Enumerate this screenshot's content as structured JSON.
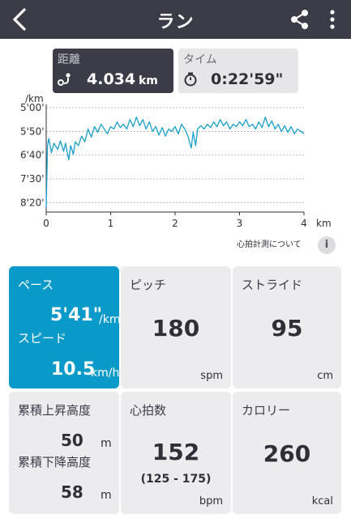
{
  "header": {
    "title": "ラン",
    "back_icon": "arrow-left-icon",
    "share_icon": "share-icon",
    "more_icon": "more-vertical-icon"
  },
  "tabs": [
    {
      "label": "距離",
      "value": "4.034",
      "unit": "km",
      "icon": "route-icon",
      "selected": true
    },
    {
      "label": "タイム",
      "value": "0:22'59\"",
      "icon": "stopwatch-icon",
      "selected": false
    }
  ],
  "chart_data": {
    "type": "line",
    "ylabel_unit": "/km",
    "xlabel": "km",
    "y_ticks": [
      "5'00'",
      "5'50'",
      "6'40'",
      "7'30'",
      "8'20'"
    ],
    "y_tick_seconds": [
      300,
      350,
      400,
      450,
      500
    ],
    "x_ticks": [
      "0",
      "1",
      "2",
      "3",
      "4"
    ],
    "xlim": [
      0,
      4
    ],
    "ylim_seconds_per_km": [
      300,
      520
    ],
    "y_inverted": true,
    "grid": true,
    "line_color": "#1a9fc9",
    "series": [
      {
        "x": [
          0,
          0.02,
          0.04,
          0.08,
          0.12,
          0.18,
          0.22,
          0.27,
          0.3,
          0.35,
          0.38,
          0.42,
          0.45,
          0.5,
          0.55,
          0.6,
          0.65,
          0.7,
          0.75,
          0.8,
          0.85,
          0.9,
          0.95,
          1.0,
          1.05,
          1.1,
          1.15,
          1.2,
          1.25,
          1.3,
          1.35,
          1.4,
          1.45,
          1.5,
          1.55,
          1.6,
          1.65,
          1.7,
          1.75,
          1.8,
          1.85,
          1.9,
          1.95,
          2.0,
          2.05,
          2.1,
          2.15,
          2.2,
          2.25,
          2.28,
          2.32,
          2.35,
          2.4,
          2.45,
          2.5,
          2.55,
          2.6,
          2.65,
          2.7,
          2.75,
          2.8,
          2.85,
          2.9,
          2.95,
          3.0,
          3.05,
          3.1,
          3.15,
          3.2,
          3.25,
          3.3,
          3.35,
          3.4,
          3.45,
          3.5,
          3.55,
          3.6,
          3.65,
          3.7,
          3.75,
          3.8,
          3.85,
          3.9,
          3.95,
          4.0
        ],
        "y": [
          510,
          380,
          365,
          395,
          375,
          388,
          370,
          392,
          375,
          410,
          380,
          398,
          372,
          380,
          360,
          372,
          345,
          362,
          340,
          352,
          335,
          345,
          355,
          340,
          345,
          330,
          342,
          335,
          345,
          325,
          340,
          320,
          338,
          325,
          345,
          330,
          350,
          340,
          358,
          342,
          360,
          345,
          350,
          340,
          355,
          335,
          345,
          360,
          385,
          352,
          380,
          345,
          338,
          345,
          335,
          342,
          330,
          340,
          325,
          338,
          330,
          345,
          335,
          340,
          330,
          338,
          325,
          340,
          335,
          345,
          330,
          342,
          320,
          340,
          328,
          345,
          335,
          350,
          338,
          352,
          340,
          355,
          345,
          350,
          355
        ]
      }
    ]
  },
  "info": {
    "text": "心拍計測について",
    "icon_label": "i"
  },
  "cards": {
    "pace": {
      "title": "ペース",
      "value": "5'41\"",
      "unit": "/km",
      "speed_label": "スピード",
      "speed_value": "10.5",
      "speed_unit": "km/h"
    },
    "pitch": {
      "title": "ピッチ",
      "value": "180",
      "unit": "spm"
    },
    "stride": {
      "title": "ストライド",
      "value": "95",
      "unit": "cm"
    },
    "elevation": {
      "ascent_label": "累積上昇高度",
      "ascent_value": "50",
      "ascent_unit": "m",
      "descent_label": "累積下降高度",
      "descent_value": "58",
      "descent_unit": "m"
    },
    "heart_rate": {
      "title": "心拍数",
      "value": "152",
      "range": "(125 - 175)",
      "unit": "bpm"
    },
    "calories": {
      "title": "カロリー",
      "value": "260",
      "unit": "kcal"
    }
  },
  "colors": {
    "header_bg": "#3b3c47",
    "accent": "#0a9ac9",
    "card_bg": "#ececee"
  }
}
